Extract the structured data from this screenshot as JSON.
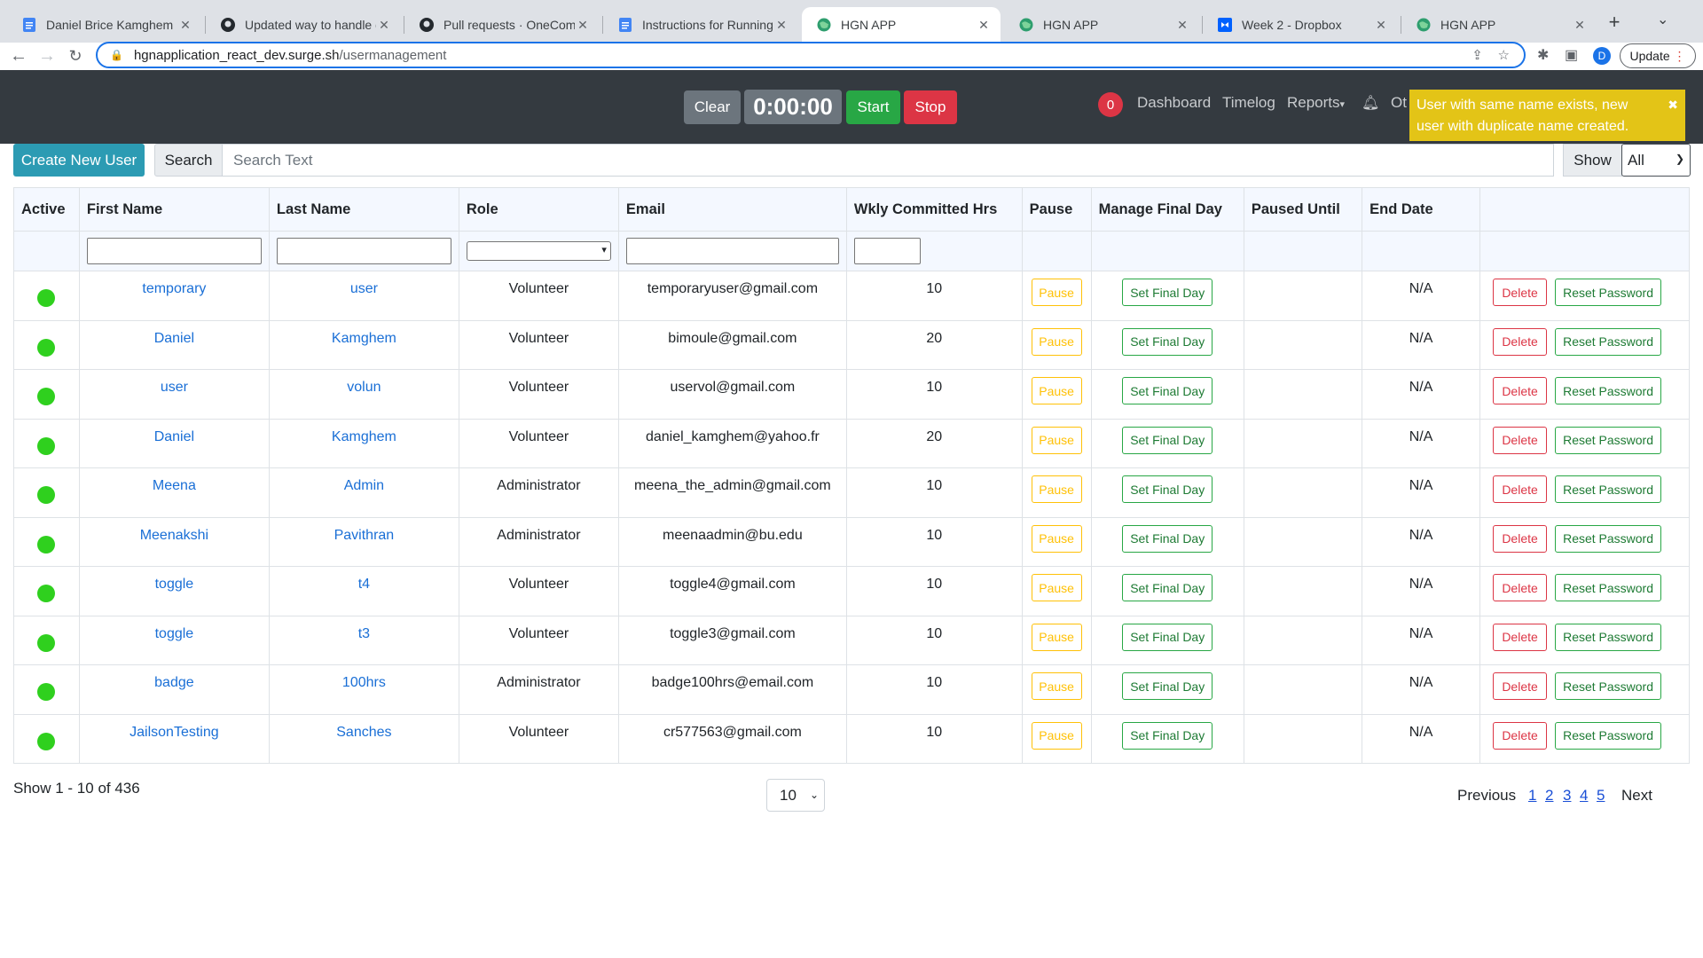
{
  "browser": {
    "tabs": [
      {
        "title": "Daniel Brice Kamghem Kom",
        "icon": "docs-icon"
      },
      {
        "title": "Updated way to handle dupl",
        "icon": "github-icon"
      },
      {
        "title": "Pull requests · OneCommun",
        "icon": "github-icon"
      },
      {
        "title": "Instructions for Running HGN",
        "icon": "docs-icon"
      },
      {
        "title": "HGN APP",
        "icon": "globe-icon"
      },
      {
        "title": "HGN APP",
        "icon": "globe-icon"
      },
      {
        "title": "Week 2 - Dropbox",
        "icon": "dropbox-icon"
      },
      {
        "title": "HGN APP",
        "icon": "globe-icon"
      }
    ],
    "active_tab_index": 4,
    "url_host": "hgnapplication_react_dev.surge.sh",
    "url_path": "/usermanagement",
    "profile_initial": "D",
    "update_label": "Update"
  },
  "header": {
    "clear_label": "Clear",
    "timer": "0:00:00",
    "start_label": "Start",
    "stop_label": "Stop",
    "notif_count": "0",
    "nav": [
      "Dashboard",
      "Timelog",
      "Reports",
      "Ot"
    ],
    "toast": "User with same name exists, new user with duplicate name created.",
    "colors": {
      "bar": "#343a40",
      "start": "#28a745",
      "stop": "#dc3545",
      "toast": "#e3c417"
    }
  },
  "toolbar": {
    "create_label": "Create New User",
    "search_label": "Search",
    "search_placeholder": "Search Text",
    "show_label": "Show",
    "show_value": "All"
  },
  "table": {
    "columns": [
      "Active",
      "First Name",
      "Last Name",
      "Role",
      "Email",
      "Wkly Committed Hrs",
      "Pause",
      "Manage Final Day",
      "Paused Until",
      "End Date"
    ],
    "pause_label": "Pause",
    "final_label": "Set Final Day",
    "delete_label": "Delete",
    "reset_label": "Reset Password",
    "rows": [
      {
        "first": "temporary",
        "last": "user",
        "role": "Volunteer",
        "email": "temporaryuser@gmail.com",
        "hrs": "10",
        "paused_until": "",
        "end": "N/A"
      },
      {
        "first": "Daniel",
        "last": "Kamghem",
        "role": "Volunteer",
        "email": "bimoule@gmail.com",
        "hrs": "20",
        "paused_until": "",
        "end": "N/A"
      },
      {
        "first": "user",
        "last": "volun",
        "role": "Volunteer",
        "email": "uservol@gmail.com",
        "hrs": "10",
        "paused_until": "",
        "end": "N/A"
      },
      {
        "first": "Daniel",
        "last": "Kamghem",
        "role": "Volunteer",
        "email": "daniel_kamghem@yahoo.fr",
        "hrs": "20",
        "paused_until": "",
        "end": "N/A"
      },
      {
        "first": "Meena",
        "last": "Admin",
        "role": "Administrator",
        "email": "meena_the_admin@gmail.com",
        "hrs": "10",
        "paused_until": "",
        "end": "N/A"
      },
      {
        "first": "Meenakshi",
        "last": "Pavithran",
        "role": "Administrator",
        "email": "meenaadmin@bu.edu",
        "hrs": "10",
        "paused_until": "",
        "end": "N/A"
      },
      {
        "first": "toggle",
        "last": "t4",
        "role": "Volunteer",
        "email": "toggle4@gmail.com",
        "hrs": "10",
        "paused_until": "",
        "end": "N/A"
      },
      {
        "first": "toggle",
        "last": "t3",
        "role": "Volunteer",
        "email": "toggle3@gmail.com",
        "hrs": "10",
        "paused_until": "",
        "end": "N/A"
      },
      {
        "first": "badge",
        "last": "100hrs",
        "role": "Administrator",
        "email": "badge100hrs@email.com",
        "hrs": "10",
        "paused_until": "",
        "end": "N/A"
      },
      {
        "first": "JailsonTesting",
        "last": "Sanches",
        "role": "Volunteer",
        "email": "cr577563@gmail.com",
        "hrs": "10",
        "paused_until": "",
        "end": "N/A"
      }
    ]
  },
  "footer": {
    "count_text": "Show 1 - 10 of 436",
    "page_size": "10",
    "prev_label": "Previous",
    "pages": [
      "1",
      "2",
      "3",
      "4",
      "5"
    ],
    "next_label": "Next"
  }
}
